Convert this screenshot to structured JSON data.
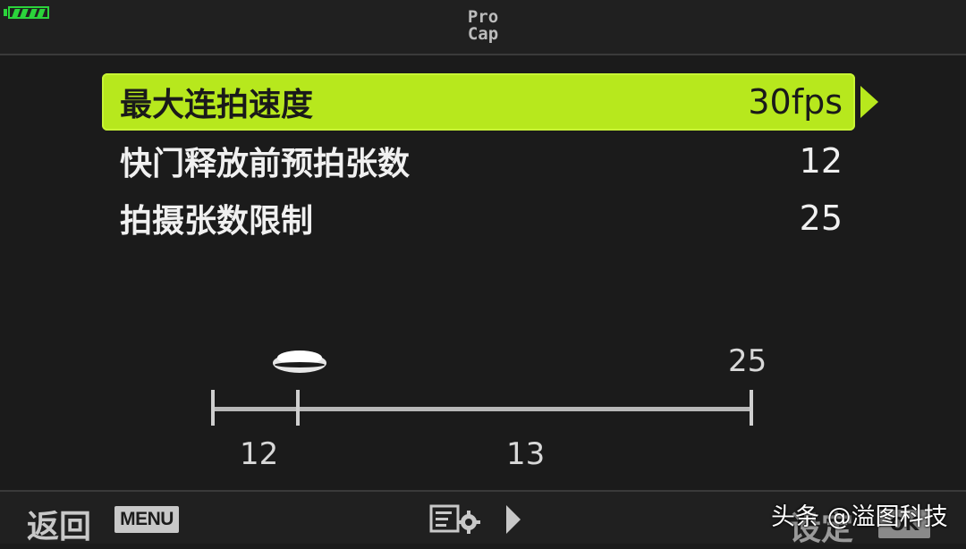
{
  "header": {
    "mode_line1": "Pro",
    "mode_line2": "Cap",
    "battery_icon": "battery-full-icon",
    "battery_color": "#2bd43b"
  },
  "menu": {
    "accent_color": "#b7e81d",
    "items": [
      {
        "label": "最大连拍速度",
        "value": "30fps",
        "selected": true
      },
      {
        "label": "快门释放前预拍张数",
        "value": "12",
        "selected": false
      },
      {
        "label": "拍摄张数限制",
        "value": "25",
        "selected": false
      }
    ]
  },
  "scale": {
    "pre_label": "12",
    "post_label": "13",
    "limit_label": "25",
    "shutter_icon": "shutter-button-icon"
  },
  "footer": {
    "back_label": "返回",
    "menu_badge": "MENU",
    "settings_icon": "menu-settings-icon",
    "set_label": "设定",
    "ok_badge": "OK",
    "watermark": "头条 @溢图科技"
  }
}
